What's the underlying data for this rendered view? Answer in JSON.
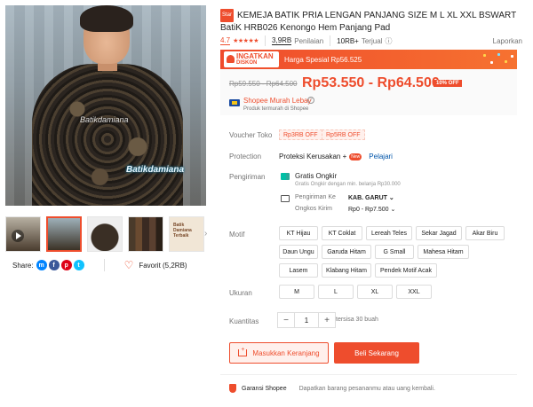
{
  "gallery": {
    "watermark_1": "Batikdamiana",
    "watermark_2": "Batikdamiana",
    "thumb_5_text": "Batik Damiana Terbaik"
  },
  "share": {
    "label": "Share:",
    "icons": [
      "messenger-icon",
      "facebook-icon",
      "pinterest-icon",
      "twitter-icon"
    ],
    "favorite_label": "Favorit (5,2RB)"
  },
  "product": {
    "badge": "Star",
    "title": "KEMEJA BATIK PRIA LENGAN PANJANG SIZE M L XL XXL BSWART BatiK HRB026 Kenongo Hem Panjang Pad",
    "rating": "4.7",
    "stars": "★★★★★",
    "reviews_count": "3,9RB",
    "reviews_label": "Penilaian",
    "sold": "10RB+",
    "sold_label": "Terjual",
    "report": "Laporkan"
  },
  "flash": {
    "logo_line1": "INGATKAN",
    "logo_line2": "DISKON",
    "special_text": "Harga Spesial Rp56.525"
  },
  "price": {
    "original": "Rp59.550 - Rp64.500",
    "current": "Rp53.550 - Rp64.500",
    "discount": "10% OFF",
    "promo_name": "Shopee Murah Lebay",
    "promo_sub": "Produk termurah di Shopee"
  },
  "voucher": {
    "label": "Voucher Toko",
    "items": [
      "Rp3RB OFF",
      "Rp5RB OFF"
    ]
  },
  "protection": {
    "label": "Protection",
    "text": "Proteksi Kerusakan +",
    "badge": "New",
    "learn": "Pelajari"
  },
  "shipping": {
    "label": "Pengiriman",
    "free_title": "Gratis Ongkir",
    "free_sub": "Gratis Ongkir dengan min. belanja Rp30.000",
    "to_label": "Pengiriman Ke",
    "to_value": "KAB. GARUT",
    "cost_label": "Ongkos Kirim",
    "cost_value": "Rp0 - Rp7.500"
  },
  "motif": {
    "label": "Motif",
    "options": [
      "KT Hijau",
      "KT Coklat",
      "Lereah Teles",
      "Sekar Jagad",
      "Akar Biru",
      "Daun Ungu",
      "Garuda Hitam",
      "G Small",
      "Mahesa Hitam",
      "Lasem",
      "Klabang Hitam",
      "Pendek Motif Acak"
    ]
  },
  "size": {
    "label": "Ukuran",
    "options": [
      "M",
      "L",
      "XL",
      "XXL"
    ]
  },
  "quantity": {
    "label": "Kuantitas",
    "minus": "−",
    "value": "1",
    "plus": "+",
    "stock": "tersisa 30 buah"
  },
  "actions": {
    "add_to_cart": "Masukkan Keranjang",
    "buy_now": "Beli Sekarang"
  },
  "guarantee": {
    "title": "Garansi Shopee",
    "desc": "Dapatkan barang pesananmu atau uang kembali."
  },
  "colors": {
    "accent": "#ee4d2d"
  }
}
